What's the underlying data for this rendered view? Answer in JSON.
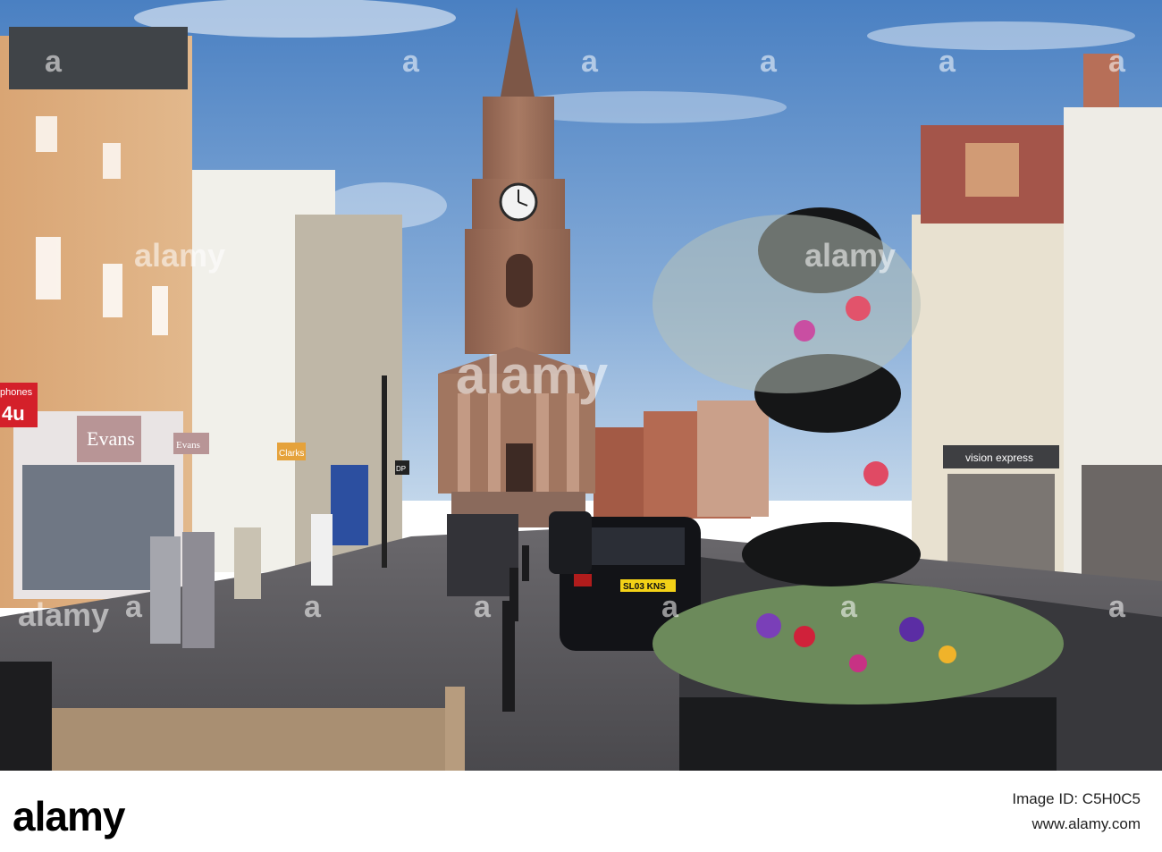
{
  "photo": {
    "description_icon": "photograph-icon",
    "shop_signs": {
      "phones": "phones",
      "phones_4u": "4u",
      "evans_main": "Evans",
      "evans_side": "Evans",
      "clarks": "Clarks",
      "dp": "DP",
      "vision_express": "vision express",
      "number_plate": "SL03 KNS"
    },
    "watermarks": [
      "alamy",
      "alamy",
      "alamy",
      "alamy",
      "a",
      "a",
      "a",
      "a",
      "a",
      "a",
      "a",
      "a",
      "a",
      "a",
      "a",
      "a"
    ]
  },
  "footer": {
    "logo": "alamy",
    "image_id_label": "Image ID: C5H0C5",
    "site": "www.alamy.com"
  },
  "colors": {
    "sky_top": "#4f86c6",
    "sky_bottom": "#b9d1ea",
    "sandstone": "#9b6f5b",
    "pavement": "#5b5a5e"
  }
}
